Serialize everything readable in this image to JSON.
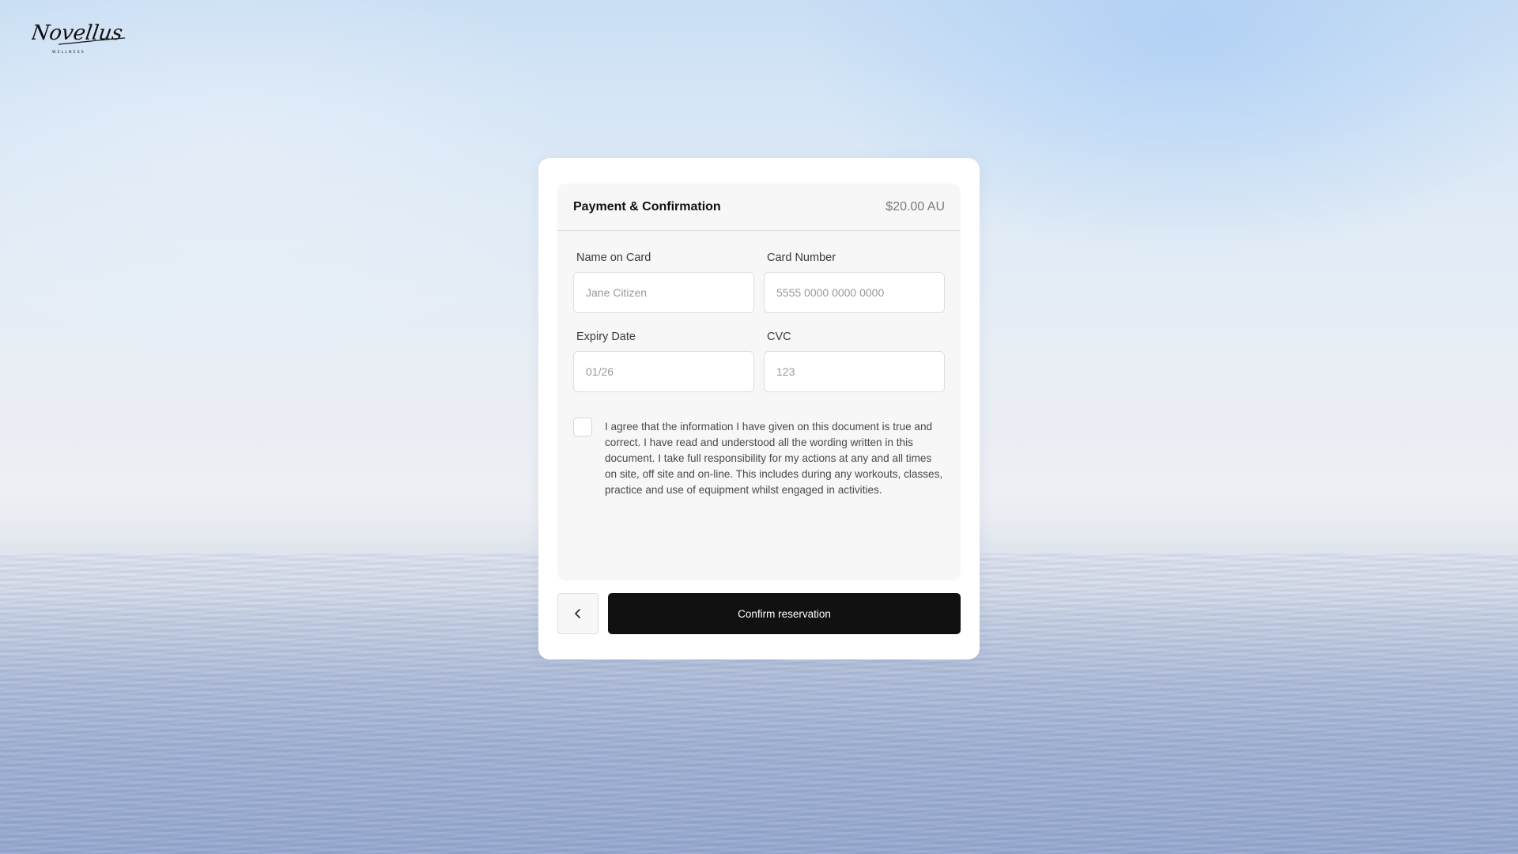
{
  "brand": {
    "logo_script": "Novellus",
    "logo_sub": "WELLNESS"
  },
  "payment": {
    "title": "Payment & Confirmation",
    "price": "$20.00 AU",
    "fields": {
      "name_label": "Name on Card",
      "name_placeholder": "Jane Citizen",
      "name_value": "",
      "card_label": "Card Number",
      "card_placeholder": "5555 0000 0000 0000",
      "card_value": "",
      "expiry_label": "Expiry Date",
      "expiry_placeholder": "01/26",
      "expiry_value": "",
      "cvc_label": "CVC",
      "cvc_placeholder": "123",
      "cvc_value": ""
    },
    "agreement": {
      "checked": false,
      "text": "I agree that the information I have given on this document is true and correct. I have read and understood all the wording written in this document. I take full responsibility for my actions at any and all times on site, off site and on-line. This includes during any workouts, classes, practice and use of equipment whilst engaged in activities."
    }
  },
  "actions": {
    "back_icon": "chevron-left-icon",
    "confirm_label": "Confirm reservation"
  },
  "colors": {
    "primary_button": "#111111",
    "panel_background": "#f7f7f7",
    "card_background": "#ffffff"
  }
}
